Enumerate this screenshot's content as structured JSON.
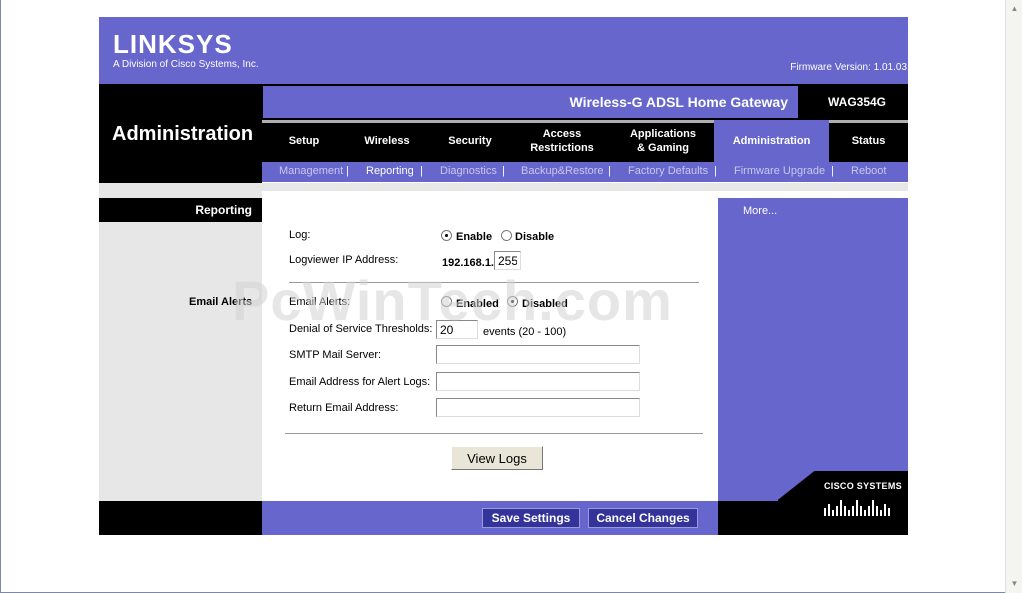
{
  "brand": {
    "logo": "LINKSYS",
    "tagline": "A Division of Cisco Systems, Inc.",
    "firmware": "Firmware Version: 1.01.03",
    "cisco": "CISCO SYSTEMS"
  },
  "section_title": "Administration",
  "product": {
    "name": "Wireless-G ADSL Home Gateway",
    "model": "WAG354G"
  },
  "tabs": [
    {
      "label": "Setup"
    },
    {
      "label": "Wireless"
    },
    {
      "label": "Security"
    },
    {
      "label": "Access Restrictions"
    },
    {
      "label": "Applications & Gaming"
    },
    {
      "label": "Administration"
    },
    {
      "label": "Status"
    }
  ],
  "subtabs": [
    {
      "label": "Management"
    },
    {
      "label": "Reporting"
    },
    {
      "label": "Diagnostics"
    },
    {
      "label": "Backup&Restore"
    },
    {
      "label": "Factory Defaults"
    },
    {
      "label": "Firmware Upgrade"
    },
    {
      "label": "Reboot"
    }
  ],
  "sidebar": {
    "reporting": "Reporting",
    "email_alerts": "Email Alerts",
    "more": "More..."
  },
  "form": {
    "log_label": "Log:",
    "enable": "Enable",
    "disable": "Disable",
    "log_value": "enable",
    "logviewer_label": "Logviewer IP Address:",
    "ip_prefix": "192.168.1.",
    "ip_last": "255",
    "email_alerts_label": "Email Alerts:",
    "enabled": "Enabled",
    "disabled": "Disabled",
    "email_alerts_value": "disabled",
    "dos_label": "Denial of Service Thresholds:",
    "dos_value": "20",
    "dos_unit": "events (20 - 100)",
    "smtp_label": "SMTP Mail Server:",
    "smtp_value": "",
    "alert_email_label": "Email Address for Alert Logs:",
    "alert_email_value": "",
    "return_email_label": "Return Email Address:",
    "return_email_value": ""
  },
  "buttons": {
    "view_logs": "View Logs",
    "save": "Save Settings",
    "cancel": "Cancel Changes"
  },
  "watermark": "PcWinTech.com",
  "colors": {
    "purple": "#6666cc",
    "black": "#000000",
    "gray": "#e7e7e7",
    "button": "#333399"
  }
}
